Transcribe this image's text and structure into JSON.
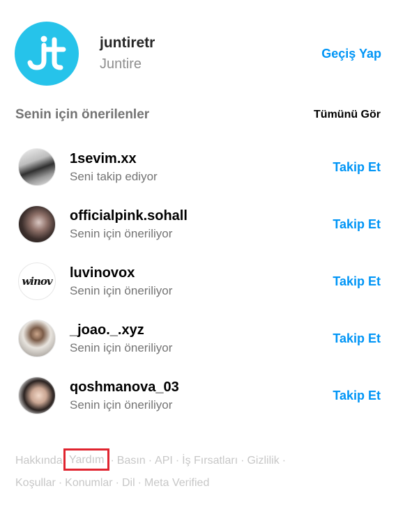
{
  "current_user": {
    "username": "juntiretr",
    "full_name": "Juntire",
    "switch_label": "Geçiş Yap",
    "avatar_icon": "juntire-logo-icon",
    "avatar_color": "#26c3ea"
  },
  "suggestions": {
    "title": "Senin için önerilenler",
    "see_all_label": "Tümünü Gör",
    "items": [
      {
        "username": "1sevim.xx",
        "subtitle": "Seni takip ediyor",
        "action": "Takip Et"
      },
      {
        "username": "officialpink.sohall",
        "subtitle": "Senin için öneriliyor",
        "action": "Takip Et"
      },
      {
        "username": "luvinovox",
        "subtitle": "Senin için öneriliyor",
        "action": "Takip Et",
        "avatar_text": "winov"
      },
      {
        "username": "_joao._.xyz",
        "subtitle": "Senin için öneriliyor",
        "action": "Takip Et"
      },
      {
        "username": "qoshmanova_03",
        "subtitle": "Senin için öneriliyor",
        "action": "Takip Et"
      }
    ]
  },
  "footer": {
    "links": [
      "Hakkında",
      "Yardım",
      "Basın",
      "API",
      "İş Fırsatları",
      "Gizlilik",
      "Koşullar",
      "Konumlar",
      "Dil",
      "Meta Verified"
    ],
    "separator": "·",
    "highlighted_link": "Yardım",
    "highlight_color": "#e0242f"
  },
  "colors": {
    "accent": "#0095f6",
    "muted_text": "#737373",
    "footer_text": "#c7c7c7"
  }
}
